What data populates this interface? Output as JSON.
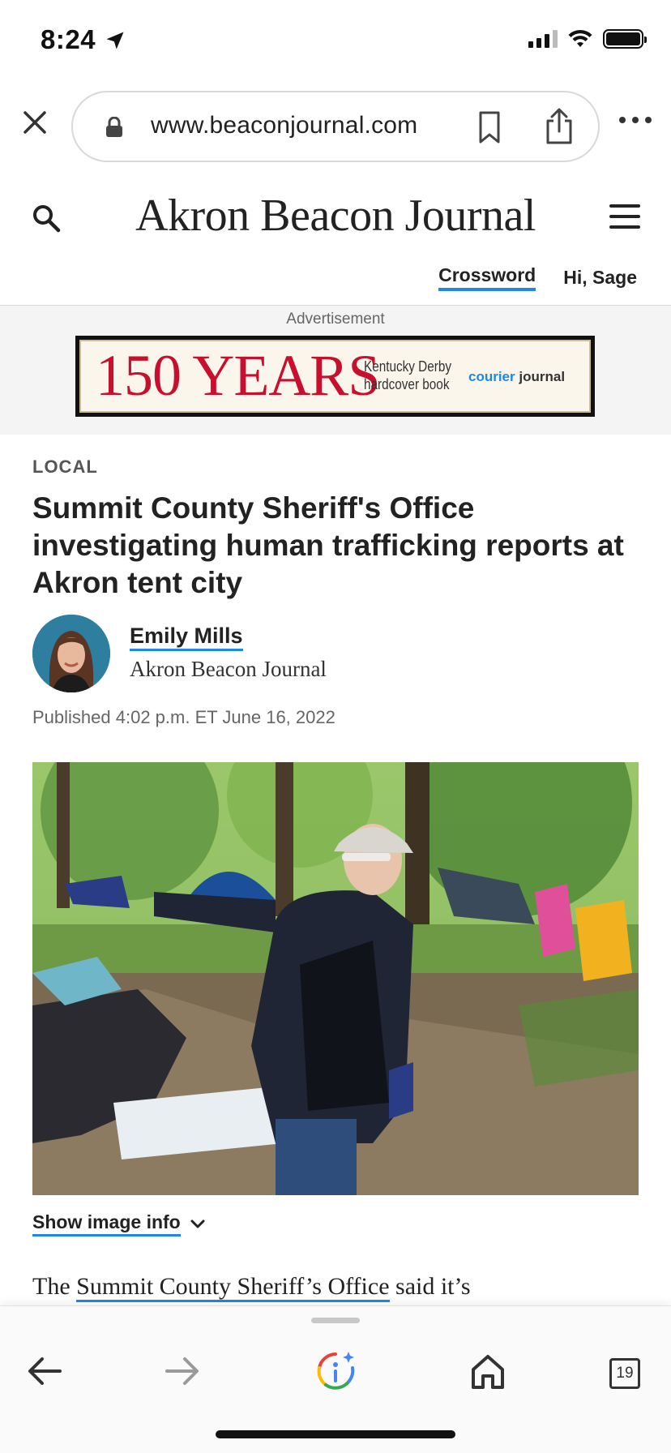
{
  "status": {
    "time": "8:24"
  },
  "browser": {
    "url": "www.beaconjournal.com",
    "tab_count": "19"
  },
  "site": {
    "title": "Akron Beacon Journal",
    "nav": {
      "crossword": "Crossword",
      "greeting": "Hi, Sage"
    }
  },
  "ad": {
    "label": "Advertisement",
    "headline": "150 YEARS",
    "line1": "Kentucky Derby",
    "line2": "hardcover book",
    "brand_a": "courier",
    "brand_b": "journal"
  },
  "article": {
    "section": "LOCAL",
    "headline": "Summit County Sheriff's Office investigating human trafficking reports at Akron tent city",
    "author": "Emily Mills",
    "organization": "Akron Beacon Journal",
    "published": "Published 4:02 p.m. ET June 16, 2022",
    "image_info_label": "Show image info",
    "body_start": "The ",
    "body_link": "Summit County Sheriff’s Office",
    "body_end": " said it’s"
  },
  "colors": {
    "link_underline": "#1e88e5",
    "ad_red": "#c8102e",
    "ad_bg": "#f4f4f4"
  },
  "icons": [
    "location-arrow-icon",
    "signal-icon",
    "wifi-icon",
    "battery-icon",
    "close-icon",
    "lock-icon",
    "bookmark-icon",
    "share-icon",
    "more-icon",
    "search-icon",
    "menu-icon",
    "chevron-down-icon",
    "back-icon",
    "forward-icon",
    "google-lens-icon",
    "home-icon",
    "tabs-icon"
  ]
}
